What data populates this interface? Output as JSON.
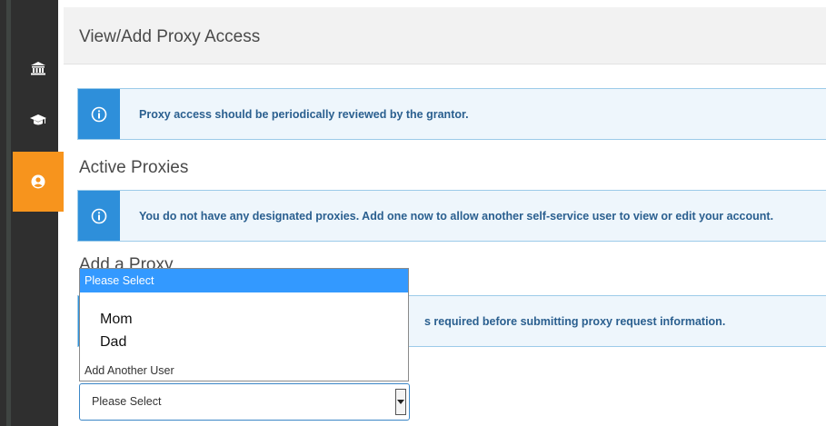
{
  "page": {
    "title": "View/Add Proxy Access"
  },
  "alerts": {
    "review": "Proxy access should be periodically reviewed by the grantor.",
    "no_proxies": "You do not have any designated proxies. Add one now to allow another self-service user to view or edit your account.",
    "partial_required": "s required before submitting proxy request information."
  },
  "sections": {
    "active_proxies": "Active Proxies",
    "add_proxy_partial": "Add a Proxy"
  },
  "proxy_select": {
    "selected_value": "Please Select",
    "options": [
      "Please Select",
      "Mom",
      "Dad",
      "Add Another User"
    ]
  },
  "sidebar": {
    "items": [
      {
        "icon": "home-icon"
      },
      {
        "icon": "bank-icon"
      },
      {
        "icon": "graduation-cap-icon"
      },
      {
        "icon": "user-circle-icon",
        "active": true
      }
    ]
  },
  "colors": {
    "sidebar_bg": "#2f2f2f",
    "active_accent": "#f7941d",
    "info_blue": "#2e8fda",
    "info_bg": "#eef6fc",
    "selected_option": "#3399ff"
  }
}
